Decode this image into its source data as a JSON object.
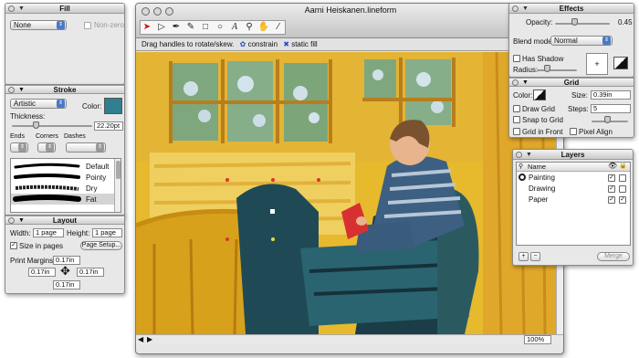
{
  "fill_panel": {
    "title": "Fill",
    "mode_value": "None",
    "nonzero_label": "Non-zero"
  },
  "stroke_panel": {
    "title": "Stroke",
    "style_value": "Artistic",
    "color_label": "Color:",
    "color": "#2f7f8f",
    "thickness_label": "Thickness:",
    "thickness_value": "22.20pt",
    "ends_label": "Ends",
    "corners_label": "Corners",
    "dashes_label": "Dashes",
    "brushes": [
      {
        "label": "Default",
        "selected": false
      },
      {
        "label": "Pointy",
        "selected": false
      },
      {
        "label": "Dry",
        "selected": false
      },
      {
        "label": "Fat",
        "selected": true
      }
    ]
  },
  "layout_panel": {
    "title": "Layout",
    "width_label": "Width:",
    "width_value": "1 page",
    "height_label": "Height:",
    "height_value": "1 page",
    "size_in_pages_label": "Size in pages",
    "page_setup_label": "Page Setup...",
    "print_margins_label": "Print Margins:",
    "margin_top": "0.17in",
    "margin_left": "0.17in",
    "margin_right": "0.17in",
    "margin_bottom": "0.17in"
  },
  "document": {
    "title": "Aarni Heiskanen.lineform",
    "hint_text": "Drag handles to rotate/skew.",
    "constrain_label": "constrain",
    "static_fill_label": "static fill",
    "zoom_value": "100%",
    "tools": [
      "arrow-tool-icon",
      "direct-select-icon",
      "pen-tool-icon",
      "pencil-tool-icon",
      "rectangle-tool-icon",
      "ellipse-tool-icon",
      "text-tool-icon",
      "zoom-tool-icon",
      "hand-tool-icon",
      "eyedropper-tool-icon"
    ]
  },
  "effects_panel": {
    "title": "Effects",
    "opacity_label": "Opacity:",
    "opacity_value": "0.45",
    "blend_mode_label": "Blend mode:",
    "blend_mode_value": "Normal",
    "has_shadow_label": "Has Shadow",
    "radius_label": "Radius:"
  },
  "grid_panel": {
    "title": "Grid",
    "color_label": "Color:",
    "size_label": "Size:",
    "size_value": "0.39in",
    "draw_grid_label": "Draw Grid",
    "steps_label": "Steps:",
    "steps_value": "5",
    "snap_label": "Snap to Grid",
    "front_label": "Grid in Front",
    "pixel_align_label": "Pixel Align"
  },
  "layers_panel": {
    "title": "Layers",
    "name_header": "Name",
    "layers": [
      {
        "name": "Painting",
        "active": true
      },
      {
        "name": "Drawing",
        "active": false
      },
      {
        "name": "Paper",
        "active": false
      }
    ],
    "add_label": "+",
    "remove_label": "−",
    "merge_label": "Merge"
  }
}
